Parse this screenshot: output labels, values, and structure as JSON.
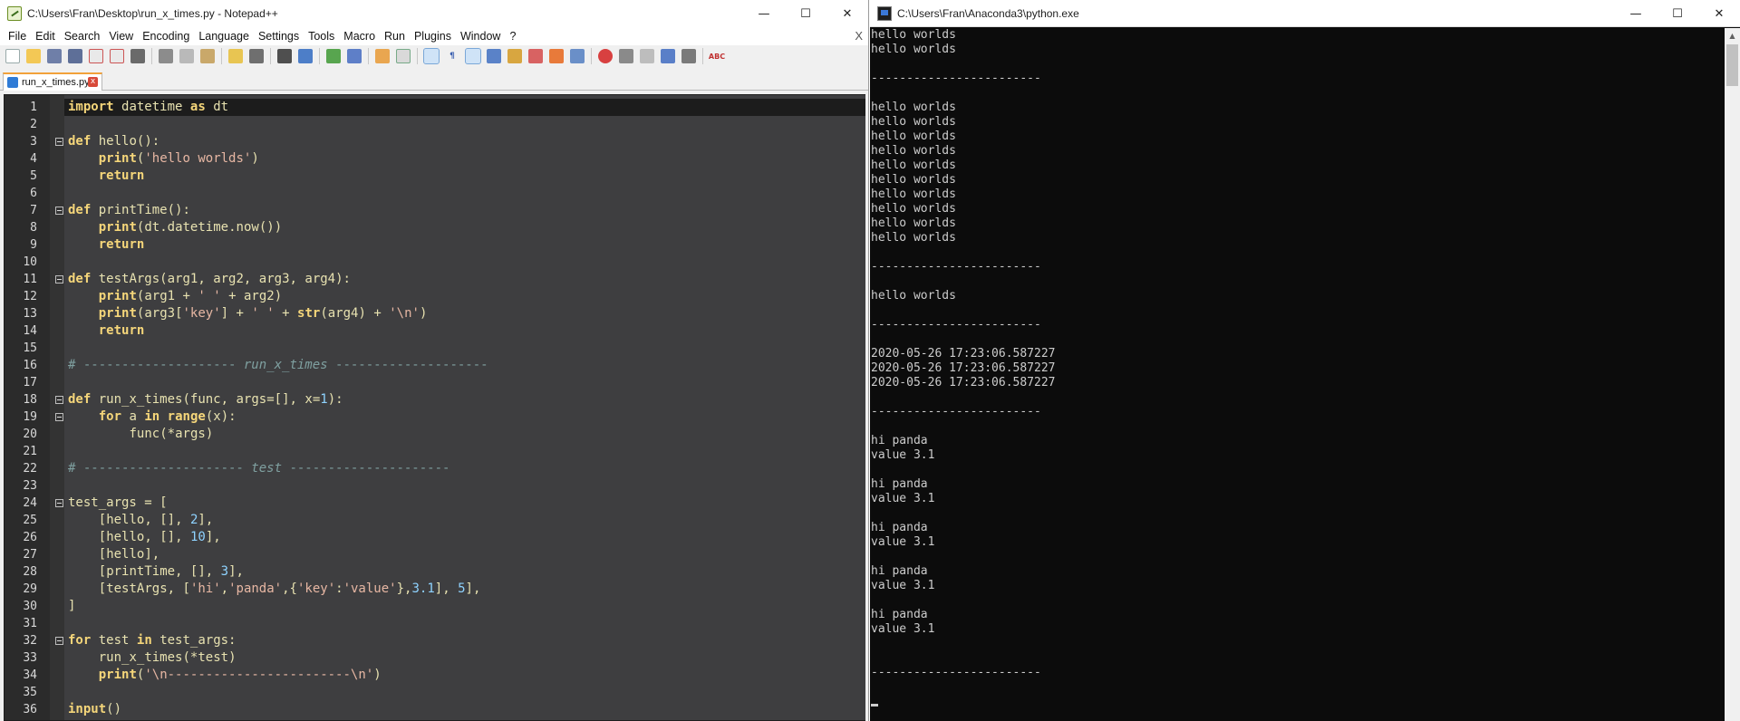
{
  "editor_window": {
    "title": "C:\\Users\\Fran\\Desktop\\run_x_times.py - Notepad++",
    "icon": "notepadpp-icon",
    "controls": {
      "minimize": "—",
      "maximize": "☐",
      "close": "✕"
    },
    "menu": [
      "File",
      "Edit",
      "Search",
      "View",
      "Encoding",
      "Language",
      "Settings",
      "Tools",
      "Macro",
      "Run",
      "Plugins",
      "Window",
      "?"
    ],
    "menu_close": "X",
    "tab": {
      "label": "run_x_times.py",
      "close": "x"
    },
    "code_lines": [
      "import datetime as dt",
      "",
      "def hello():",
      "    print('hello worlds')",
      "    return",
      "",
      "def printTime():",
      "    print(dt.datetime.now())",
      "    return",
      "",
      "def testArgs(arg1, arg2, arg3, arg4):",
      "    print(arg1 + ' ' + arg2)",
      "    print(arg3['key'] + ' ' + str(arg4) + '\\n')",
      "    return",
      "",
      "# -------------------- run_x_times --------------------",
      "",
      "def run_x_times(func, args=[], x=1):",
      "    for a in range(x):",
      "        func(*args)",
      "",
      "# --------------------- test ---------------------",
      "",
      "test_args = [",
      "    [hello, [], 2],",
      "    [hello, [], 10],",
      "    [hello],",
      "    [printTime, [], 3],",
      "    [testArgs, ['hi','panda',{'key':'value'},3.1], 5],",
      "]",
      "",
      "for test in test_args:",
      "    run_x_times(*test)",
      "    print('\\n------------------------\\n')",
      "",
      "input()"
    ]
  },
  "console_window": {
    "title": "C:\\Users\\Fran\\Anaconda3\\python.exe",
    "icon": "python-console-icon",
    "controls": {
      "minimize": "—",
      "maximize": "☐",
      "close": "✕"
    },
    "lines": [
      "hello worlds",
      "hello worlds",
      "",
      "------------------------",
      "",
      "hello worlds",
      "hello worlds",
      "hello worlds",
      "hello worlds",
      "hello worlds",
      "hello worlds",
      "hello worlds",
      "hello worlds",
      "hello worlds",
      "hello worlds",
      "",
      "------------------------",
      "",
      "hello worlds",
      "",
      "------------------------",
      "",
      "2020-05-26 17:23:06.587227",
      "2020-05-26 17:23:06.587227",
      "2020-05-26 17:23:06.587227",
      "",
      "------------------------",
      "",
      "hi panda",
      "value 3.1",
      "",
      "hi panda",
      "value 3.1",
      "",
      "hi panda",
      "value 3.1",
      "",
      "hi panda",
      "value 3.1",
      "",
      "hi panda",
      "value 3.1",
      "",
      "",
      "------------------------"
    ]
  },
  "colors": {
    "editor_bg": "#3e3e40",
    "current_line_bg": "#1c1c1c",
    "keyword": "#f5d67a",
    "string": "#e7b7a3",
    "number": "#8fd3ff",
    "comment": "#7fa0a0",
    "console_bg": "#0c0c0c",
    "console_fg": "#cccccc",
    "tab_accent": "#f2a13a"
  }
}
